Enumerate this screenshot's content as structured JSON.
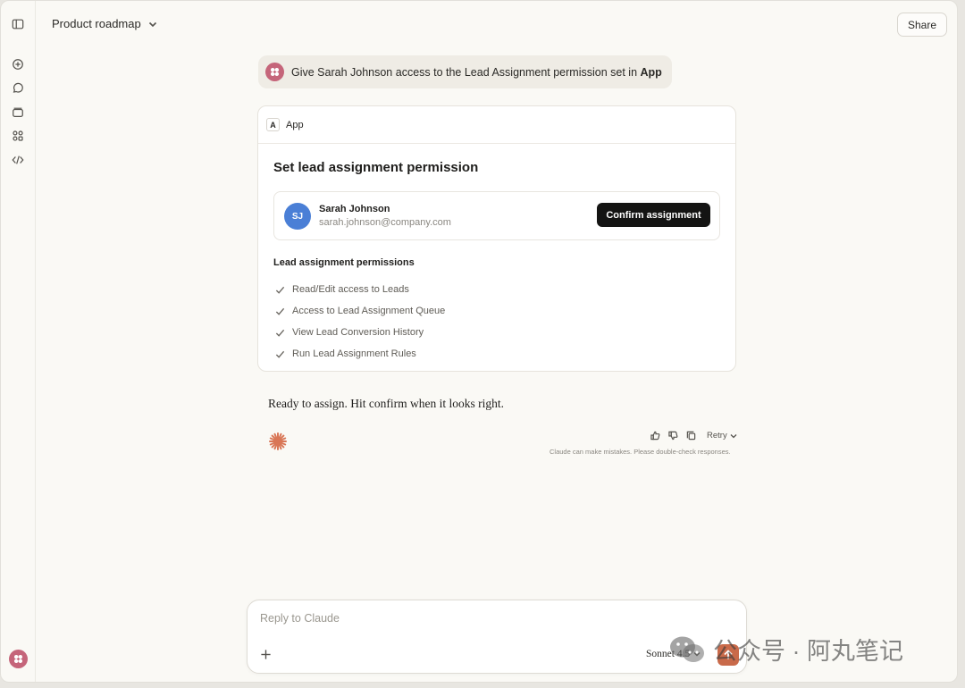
{
  "header": {
    "doc_title": "Product roadmap",
    "share_label": "Share"
  },
  "sidebar": {
    "icons": [
      "sidebar-toggle-icon",
      "new-chat-icon",
      "chats-icon",
      "projects-icon",
      "artifacts-icon",
      "code-icon"
    ]
  },
  "user_message": {
    "text_before": "Give Sarah Johnson access to the Lead Assignment permission set in ",
    "text_bold": "App"
  },
  "app_card": {
    "app_badge": "A",
    "app_name": "App",
    "title": "Set lead assignment permission",
    "person": {
      "initials": "SJ",
      "name": "Sarah Johnson",
      "email": "sarah.johnson@company.com"
    },
    "confirm_label": "Confirm assignment",
    "permissions_heading": "Lead assignment permissions",
    "permissions": [
      "Read/Edit access to Leads",
      "Access to Lead Assignment Queue",
      "View Lead Conversion History",
      "Run Lead Assignment Rules"
    ]
  },
  "assistant": {
    "reply": "Ready to assign. Hit confirm when it looks right.",
    "retry_label": "Retry",
    "disclaimer": "Claude can make mistakes. Please double-check responses."
  },
  "composer": {
    "placeholder": "Reply to Claude",
    "model": "Sonnet 4.5"
  },
  "watermark": {
    "text": "公众号 · 阿丸笔记"
  },
  "colors": {
    "background": "#faf9f5",
    "accent": "#c96a4a",
    "avatar_blue": "#4a7fd6",
    "user_avatar": "#c5657a",
    "button_dark": "#141413"
  }
}
